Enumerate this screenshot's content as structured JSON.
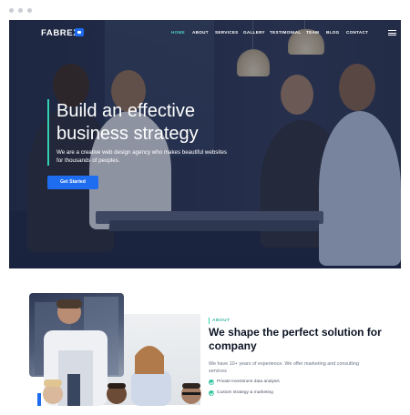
{
  "nav": {
    "logo": "FABREX",
    "items": [
      "HOME",
      "ABOUT",
      "SERVICES",
      "GALLERY",
      "TESTIMONIAL",
      "TEAM",
      "BLOG",
      "CONTACT"
    ],
    "active_index": 0
  },
  "hero": {
    "title_line1": "Build an effective",
    "title_line2": "business strategy",
    "subtitle": "We are a creative web design agency who makes beautiful websites for thousands of peoples.",
    "cta": "Get Started"
  },
  "about": {
    "label": "ABOUT",
    "title": "We shape the perfect solution for company",
    "description": "We have 10+ years of experience. We offer marketing and consulting services",
    "checklist": [
      "Private investment data analysis",
      "Custom strategy & marketing"
    ]
  },
  "colors": {
    "accent_teal": "#33d0b2",
    "brand_blue": "#1e6cf0",
    "hero_overlay": "#1c2540",
    "heading_dark": "#0c1424"
  },
  "icons": {
    "logo_badge": "chat-icon",
    "menu": "hamburger-icon",
    "check": "check-icon"
  }
}
